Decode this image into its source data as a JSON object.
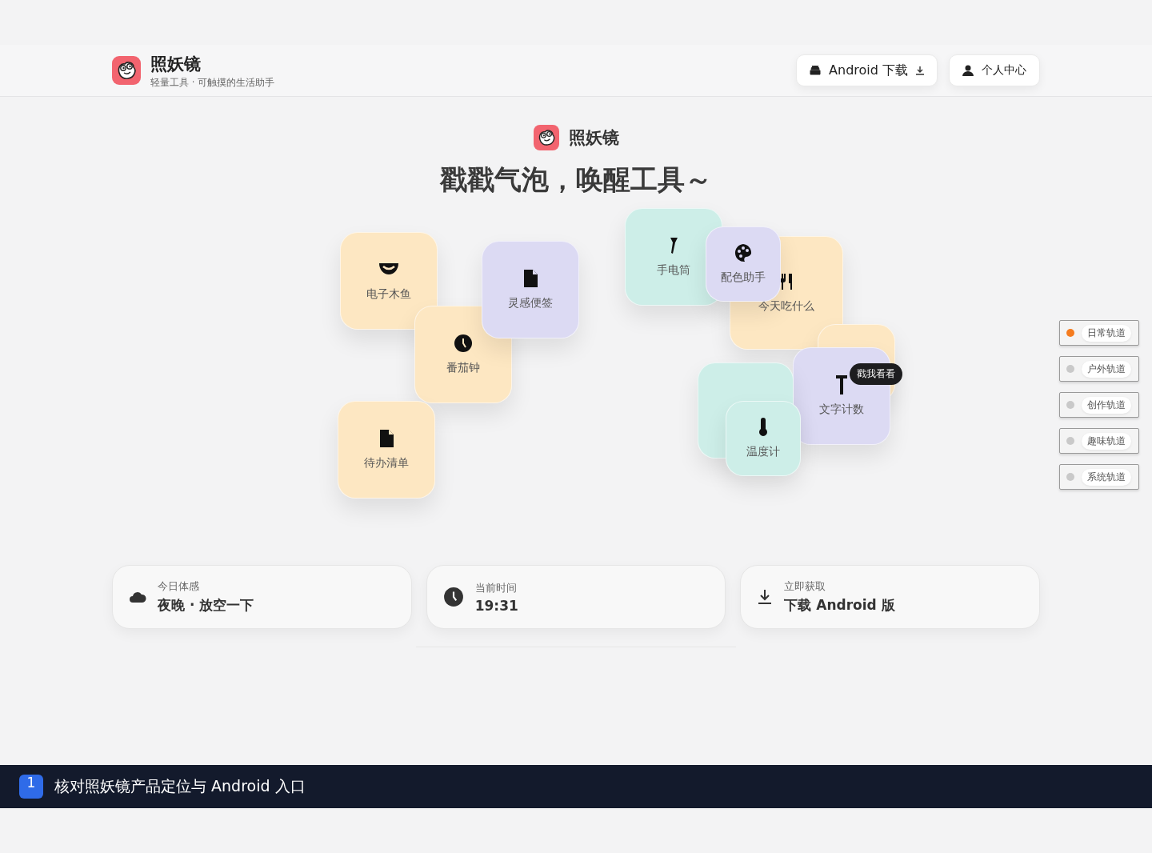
{
  "header": {
    "app_name": "照妖镜",
    "tagline": "轻量工具 · 可触摸的生活助手",
    "buttons": [
      {
        "label": "Android 下载",
        "kind": "download"
      },
      {
        "label": "个人中心",
        "kind": "account"
      }
    ]
  },
  "hero": {
    "app_name": "照妖镜",
    "headline": "戳戳气泡，唤醒工具～"
  },
  "bubbles": [
    {
      "label": "电子木鱼",
      "color": "#fde7c2"
    },
    {
      "label": "番茄钟",
      "color": "#fde7c2"
    },
    {
      "label": "灵感便签",
      "color": "#dcdaf3"
    },
    {
      "label": "待办清单",
      "color": "#fde7c2"
    },
    {
      "label": "手电筒",
      "color": "#cdeee8"
    },
    {
      "label": "今天吃什么",
      "color": "#fde7c2"
    },
    {
      "label": "配色助手",
      "color": "#dcdaf3"
    },
    {
      "color": "#fde7c2"
    },
    {
      "label": "文字计数",
      "color": "#dcdaf3"
    },
    {
      "color": "#cdeee8"
    },
    {
      "label": "温度计",
      "color": "#cdeee8"
    }
  ],
  "tooltip": "戳我看看",
  "tracks": [
    {
      "label": "日常轨道",
      "selected": true
    },
    {
      "label": "户外轨道",
      "selected": false
    },
    {
      "label": "创作轨道",
      "selected": false
    },
    {
      "label": "趣味轨道",
      "selected": false
    },
    {
      "label": "系统轨道",
      "selected": false
    }
  ],
  "info_cards": [
    {
      "label": "今日体感",
      "value": "夜晚 · 放空一下"
    },
    {
      "label": "当前时间",
      "value": "19:31"
    },
    {
      "label": "立即获取",
      "value": "下载 Android 版"
    }
  ],
  "annotation": {
    "number": "1",
    "text": "核对照妖镜产品定位与 Android 入口"
  }
}
